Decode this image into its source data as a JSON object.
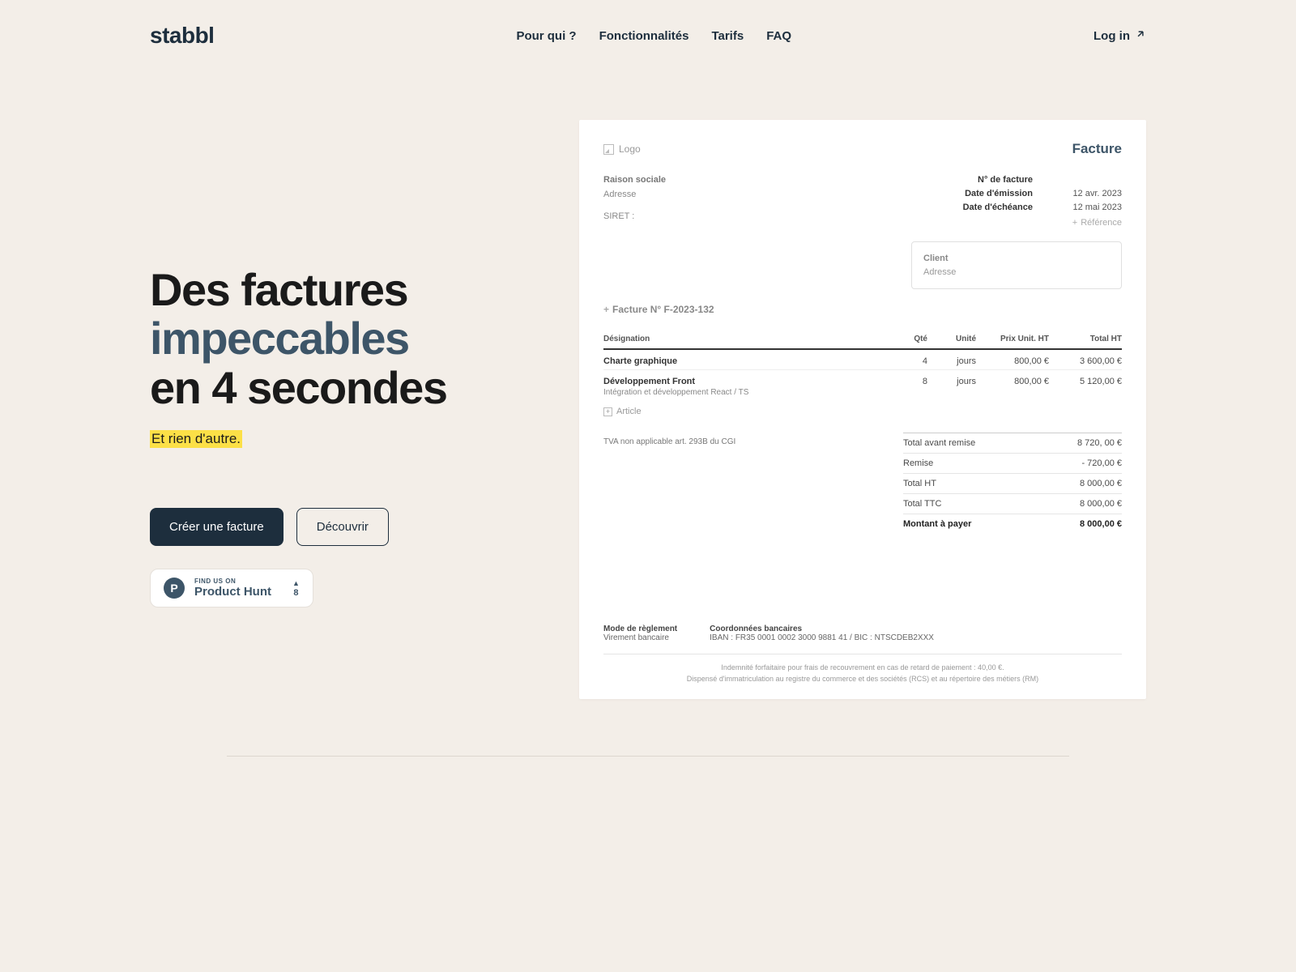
{
  "brand": "stabbl",
  "nav": {
    "items": [
      "Pour qui ?",
      "Fonctionnalités",
      "Tarifs",
      "FAQ"
    ],
    "login": "Log in"
  },
  "hero": {
    "line1": "Des factures",
    "line2": "impeccables",
    "line3": "en 4 secondes",
    "tagline": "Et rien d'autre.",
    "cta_primary": "Créer une facture",
    "cta_secondary": "Découvrir"
  },
  "producthunt": {
    "find": "FIND US ON",
    "name": "Product Hunt",
    "letter": "P",
    "votes": "8"
  },
  "invoice": {
    "logo_label": "Logo",
    "title": "Facture",
    "sender": {
      "company": "Raison sociale",
      "address": "Adresse",
      "siret": "SIRET :"
    },
    "meta": {
      "number_label": "N° de facture",
      "number_value": "",
      "issue_label": "Date d'émission",
      "issue_value": "12 avr. 2023",
      "due_label": "Date d'échéance",
      "due_value": "12 mai 2023",
      "reference": "Référence"
    },
    "client": {
      "name": "Client",
      "address": "Adresse"
    },
    "number_line": "Facture N° F-2023-132",
    "columns": {
      "designation": "Désignation",
      "qty": "Qté",
      "unit": "Unité",
      "unit_price": "Prix Unit. HT",
      "total": "Total HT"
    },
    "lines": [
      {
        "name": "Charte graphique",
        "sub": "",
        "qty": "4",
        "unit": "jours",
        "price": "800,00 €",
        "total": "3 600,00 €"
      },
      {
        "name": "Développement Front",
        "sub": "Intégration et développement React / TS",
        "qty": "8",
        "unit": "jours",
        "price": "800,00 €",
        "total": "5 120,00 €"
      }
    ],
    "add_article": "Article",
    "tva_note": "TVA non applicable art. 293B du CGI",
    "totals": {
      "before_discount_label": "Total avant remise",
      "before_discount_value": "8 720, 00 €",
      "discount_label": "Remise",
      "discount_value": "- 720,00 €",
      "ht_label": "Total HT",
      "ht_value": "8 000,00 €",
      "ttc_label": "Total TTC",
      "ttc_value": "8 000,00 €",
      "pay_label": "Montant à payer",
      "pay_value": "8 000,00 €"
    },
    "payment": {
      "mode_label": "Mode de règlement",
      "mode_value": "Virement bancaire",
      "bank_label": "Coordonnées bancaires",
      "bank_value": "IBAN : FR35 0001 0002 3000 9881 41 / BIC : NTSCDEB2XXX"
    },
    "legal1": "Indemnité forfaitaire pour frais de recouvrement en cas de retard de paiement : 40,00 €.",
    "legal2": "Dispensé d'immatriculation au registre du commerce et des sociétés (RCS) et au répertoire des métiers (RM)"
  }
}
